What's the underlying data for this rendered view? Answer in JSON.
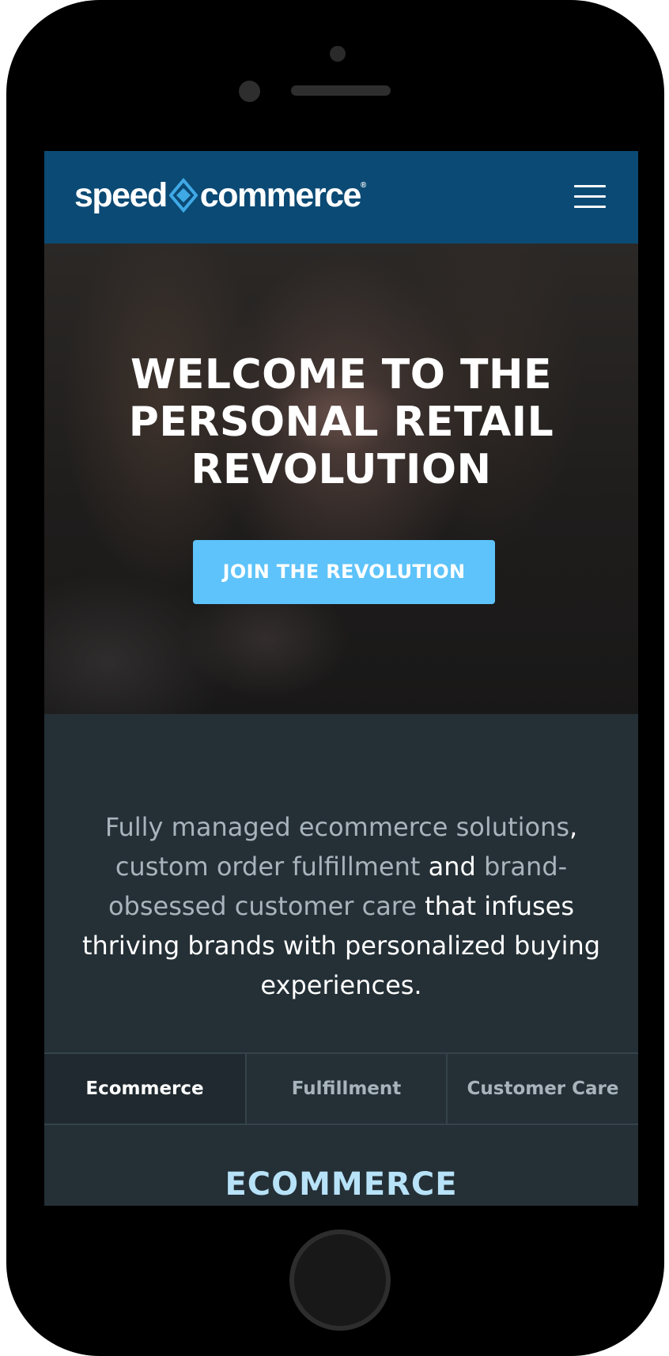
{
  "header": {
    "logo_word_1": "speed",
    "logo_word_2": "commerce",
    "logo_reg": "®",
    "menu_icon": "hamburger-menu-icon"
  },
  "hero": {
    "title_lines": [
      "WELCOME TO THE",
      "PERSONAL RETAIL",
      "REVOLUTION"
    ],
    "cta_label": "JOIN THE REVOLUTION"
  },
  "intro": {
    "part_1": "Fully managed ecommerce solutions",
    "part_2": ",",
    "part_3": "custom order fulfillment",
    "part_4": " and ",
    "part_5": "brand-obsessed customer care",
    "part_6": " that infuses thriving brands with personalized buying experiences."
  },
  "tabs": [
    {
      "label": "Ecommerce",
      "active": true
    },
    {
      "label": "Fulfillment",
      "active": false
    },
    {
      "label": "Customer Care",
      "active": false
    }
  ],
  "section": {
    "title": "ECOMMERCE"
  },
  "colors": {
    "header_bg": "#0b4a74",
    "cta_bg": "#5ec3fa",
    "body_bg": "#242f36",
    "section_title": "#b7e2f7",
    "muted_text": "#a8b4bc"
  }
}
